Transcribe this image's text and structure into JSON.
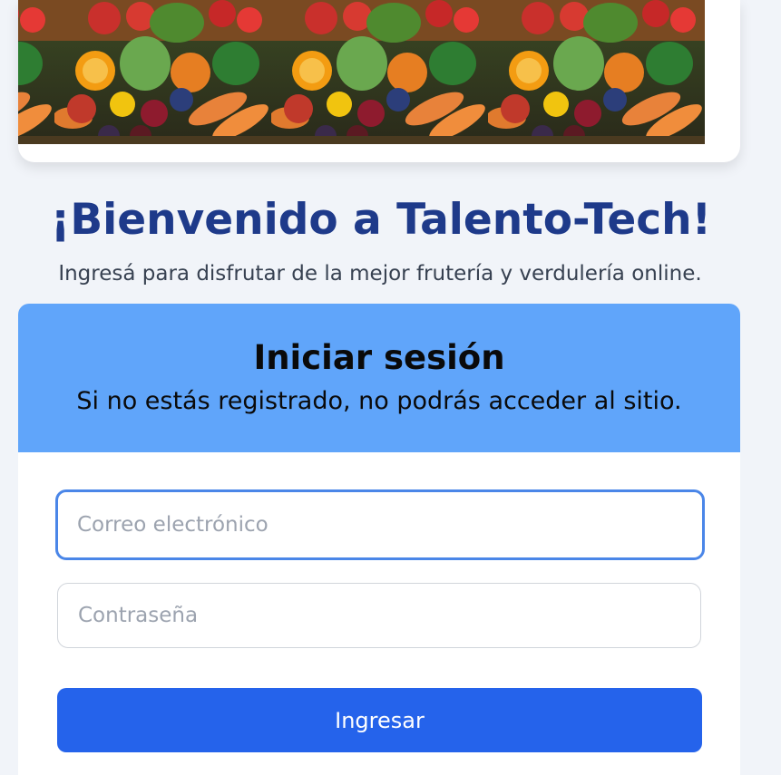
{
  "banner": {
    "image_alt": "produce-collage"
  },
  "welcome": {
    "title": "¡Bienvenido a Talento-Tech!",
    "subtitle": "Ingresá para disfrutar de la mejor frutería y verdulería online."
  },
  "login": {
    "title": "Iniciar sesión",
    "note": "Si no estás registrado, no podrás acceder al sitio.",
    "email_placeholder": "Correo electrónico",
    "password_placeholder": "Contraseña",
    "submit_label": "Ingresar"
  },
  "colors": {
    "title": "#1e3a8a",
    "header_bg": "#60a5fa",
    "button_bg": "#2563eb",
    "focus_border": "#4a86e8"
  }
}
